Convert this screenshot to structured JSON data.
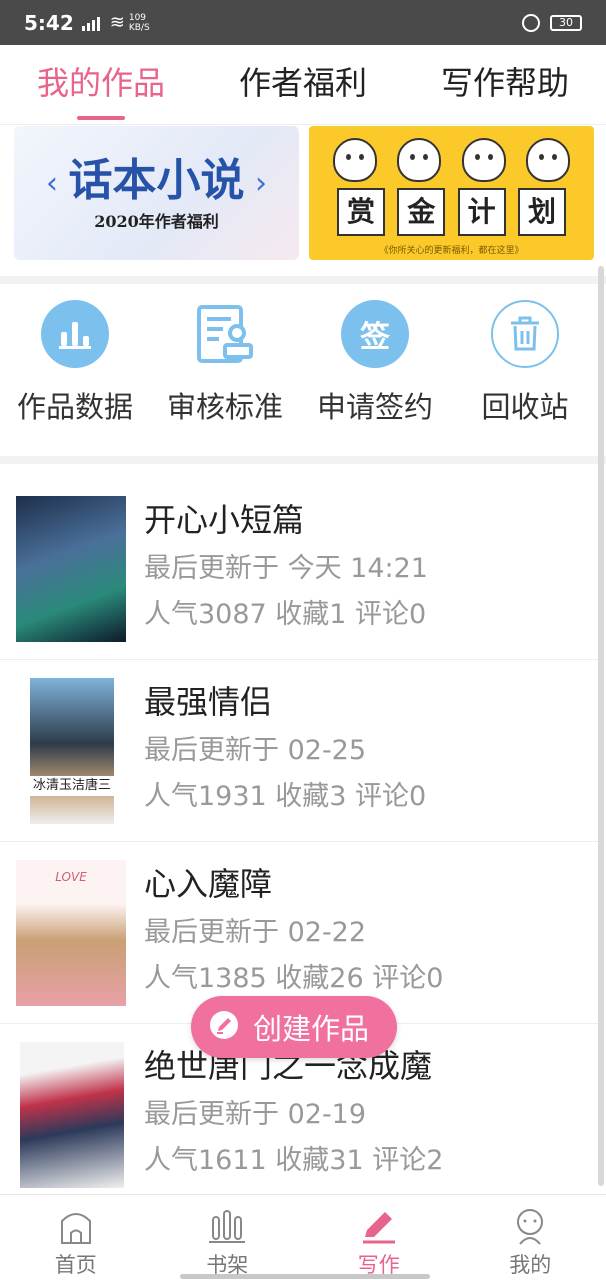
{
  "status_bar": {
    "time": "5:42",
    "net_speed_value": "109",
    "net_speed_unit": "KB/S",
    "battery": "30"
  },
  "tabs": [
    {
      "label": "我的作品",
      "active": true
    },
    {
      "label": "作者福利",
      "active": false
    },
    {
      "label": "写作帮助",
      "active": false
    }
  ],
  "banners": {
    "left": {
      "title": "话本小说",
      "subtitle": "2020年作者福利",
      "prev": "‹",
      "next": "›"
    },
    "right": {
      "chars": [
        "赏",
        "金",
        "计",
        "划"
      ],
      "subtitle": "《你所关心的更新福利，都在这里》"
    }
  },
  "actions": [
    {
      "label": "作品数据",
      "icon": "bar-chart-icon"
    },
    {
      "label": "审核标准",
      "icon": "document-stamp-icon"
    },
    {
      "label": "申请签约",
      "icon": "sign-icon",
      "glyph": "签"
    },
    {
      "label": "回收站",
      "icon": "trash-icon"
    }
  ],
  "works": [
    {
      "title": "开心小短篇",
      "updated": "最后更新于 今天 14:21",
      "stats": "人气3087 收藏1 评论0"
    },
    {
      "title": "最强情侣",
      "updated": "最后更新于 02-25",
      "stats": "人气1931 收藏3 评论0",
      "cover_text": "冰清玉洁唐三"
    },
    {
      "title": "心入魔障",
      "updated": "最后更新于 02-22",
      "stats": "人气1385 收藏26 评论0",
      "cover_text": "LOVE"
    },
    {
      "title": "绝世唐门之一念成魔",
      "updated": "最后更新于 02-19",
      "stats": "人气1611 收藏31 评论2"
    }
  ],
  "fab": {
    "label": "创建作品"
  },
  "bottom_nav": [
    {
      "label": "首页",
      "icon": "home-icon",
      "active": false
    },
    {
      "label": "书架",
      "icon": "bookshelf-icon",
      "active": false
    },
    {
      "label": "写作",
      "icon": "pen-icon",
      "active": true
    },
    {
      "label": "我的",
      "icon": "profile-icon",
      "active": false
    }
  ],
  "colors": {
    "accent": "#e8648a",
    "icon_blue": "#7cc0ee",
    "banner_yellow": "#fbc92a"
  }
}
